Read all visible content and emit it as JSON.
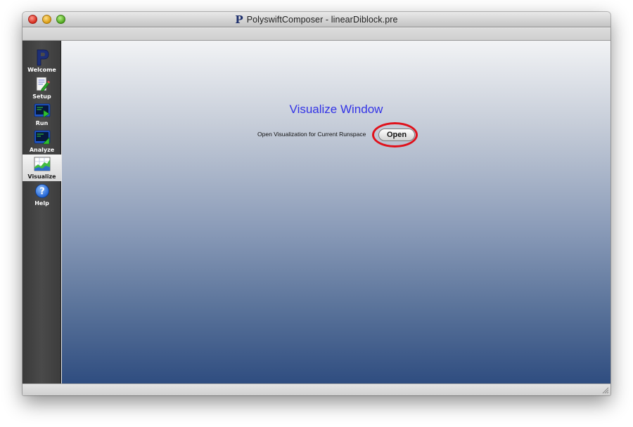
{
  "window": {
    "title": "PolyswiftComposer - linearDiblock.pre",
    "app_icon_glyph": "P"
  },
  "sidebar": {
    "items": [
      {
        "label": "Welcome",
        "icon": "polyswift-logo-icon",
        "selected": false
      },
      {
        "label": "Setup",
        "icon": "document-edit-icon",
        "selected": false
      },
      {
        "label": "Run",
        "icon": "terminal-run-icon",
        "selected": false
      },
      {
        "label": "Analyze",
        "icon": "terminal-analyze-icon",
        "selected": false
      },
      {
        "label": "Visualize",
        "icon": "chart-visualize-icon",
        "selected": true
      },
      {
        "label": "Help",
        "icon": "help-question-icon",
        "selected": false
      }
    ]
  },
  "main": {
    "title": "Visualize Window",
    "open_label": "Open Visualization for Current Runspace",
    "open_button": "Open"
  },
  "colors": {
    "title_text": "#3333e6",
    "highlight": "#e0111b",
    "gradient_top": "#f2f3f5",
    "gradient_bottom": "#2f4d80"
  }
}
